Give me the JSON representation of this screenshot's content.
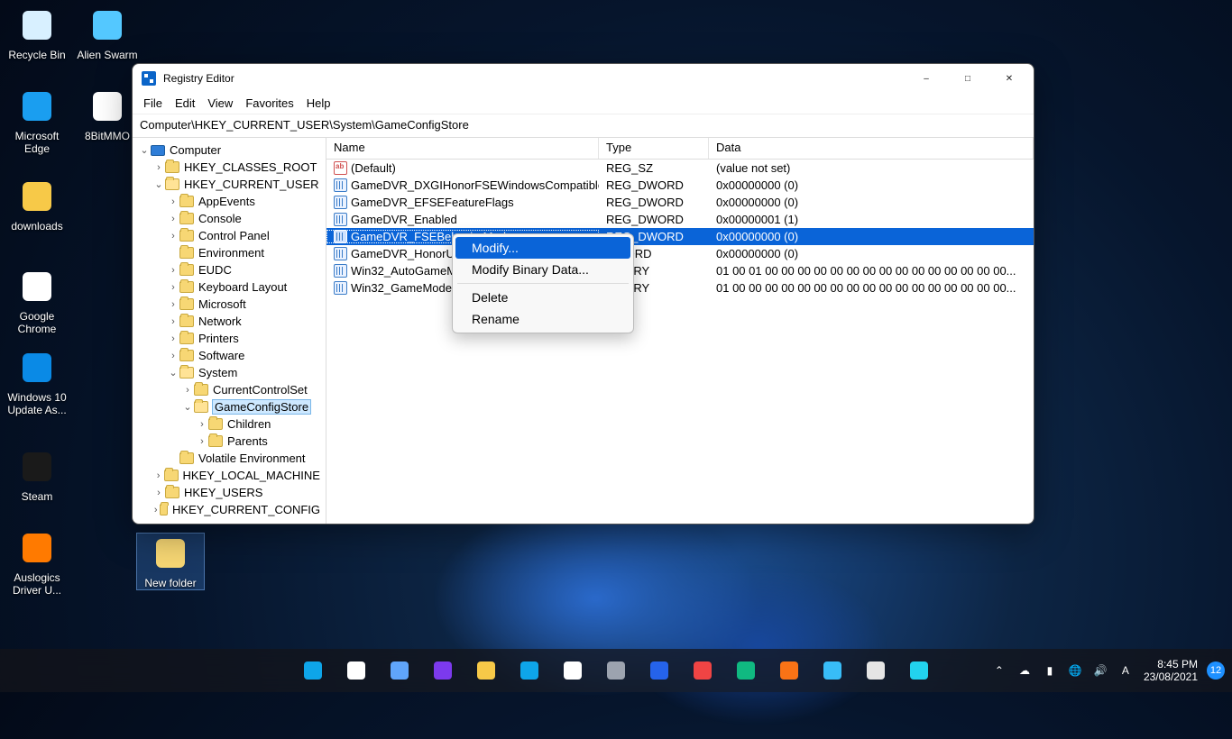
{
  "desktop": [
    {
      "name": "recycle-bin",
      "label": "Recycle Bin",
      "color": "#d8f0ff"
    },
    {
      "name": "alien-swarm",
      "label": "Alien Swarm",
      "color": "#54c8ff"
    },
    {
      "name": "microsoft-edge",
      "label": "Microsoft Edge",
      "color": "#1a9ef0"
    },
    {
      "name": "8bitmmo",
      "label": "8BitMMO",
      "color": "#ffffff"
    },
    {
      "name": "downloads",
      "label": "downloads",
      "color": "#f7c948"
    },
    {
      "name": "google-chrome",
      "label": "Google Chrome",
      "color": "#ffffff"
    },
    {
      "name": "windows10-update-assistant",
      "label": "Windows 10 Update As...",
      "color": "#0a8ae6"
    },
    {
      "name": "steam",
      "label": "Steam",
      "color": "#1a1a1a"
    },
    {
      "name": "auslogics-driver-updater",
      "label": "Auslogics Driver U...",
      "color": "#ff7a00"
    },
    {
      "name": "new-folder",
      "label": "New folder",
      "color": "#f7d774",
      "selected": true
    }
  ],
  "window": {
    "title": "Registry Editor",
    "menus": [
      "File",
      "Edit",
      "View",
      "Favorites",
      "Help"
    ],
    "address": "Computer\\HKEY_CURRENT_USER\\System\\GameConfigStore",
    "tree": [
      {
        "d": 0,
        "tw": "v",
        "ico": "comp",
        "label": "Computer"
      },
      {
        "d": 1,
        "tw": ">",
        "ico": "fld",
        "label": "HKEY_CLASSES_ROOT"
      },
      {
        "d": 1,
        "tw": "v",
        "ico": "fldo",
        "label": "HKEY_CURRENT_USER"
      },
      {
        "d": 2,
        "tw": ">",
        "ico": "fld",
        "label": "AppEvents"
      },
      {
        "d": 2,
        "tw": ">",
        "ico": "fld",
        "label": "Console"
      },
      {
        "d": 2,
        "tw": ">",
        "ico": "fld",
        "label": "Control Panel"
      },
      {
        "d": 2,
        "tw": "",
        "ico": "fld",
        "label": "Environment"
      },
      {
        "d": 2,
        "tw": ">",
        "ico": "fld",
        "label": "EUDC"
      },
      {
        "d": 2,
        "tw": ">",
        "ico": "fld",
        "label": "Keyboard Layout"
      },
      {
        "d": 2,
        "tw": ">",
        "ico": "fld",
        "label": "Microsoft"
      },
      {
        "d": 2,
        "tw": ">",
        "ico": "fld",
        "label": "Network"
      },
      {
        "d": 2,
        "tw": ">",
        "ico": "fld",
        "label": "Printers"
      },
      {
        "d": 2,
        "tw": ">",
        "ico": "fld",
        "label": "Software"
      },
      {
        "d": 2,
        "tw": "v",
        "ico": "fldo",
        "label": "System"
      },
      {
        "d": 3,
        "tw": ">",
        "ico": "fld",
        "label": "CurrentControlSet"
      },
      {
        "d": 3,
        "tw": "v",
        "ico": "fldo",
        "label": "GameConfigStore",
        "sel": true
      },
      {
        "d": 4,
        "tw": ">",
        "ico": "fld",
        "label": "Children"
      },
      {
        "d": 4,
        "tw": ">",
        "ico": "fld",
        "label": "Parents"
      },
      {
        "d": 2,
        "tw": "",
        "ico": "fld",
        "label": "Volatile Environment"
      },
      {
        "d": 1,
        "tw": ">",
        "ico": "fld",
        "label": "HKEY_LOCAL_MACHINE"
      },
      {
        "d": 1,
        "tw": ">",
        "ico": "fld",
        "label": "HKEY_USERS"
      },
      {
        "d": 1,
        "tw": ">",
        "ico": "fld",
        "label": "HKEY_CURRENT_CONFIG"
      }
    ],
    "columns": {
      "name": "Name",
      "type": "Type",
      "data": "Data"
    },
    "values": [
      {
        "ico": "sz",
        "name": "(Default)",
        "type": "REG_SZ",
        "data": "(value not set)"
      },
      {
        "ico": "dw",
        "name": "GameDVR_DXGIHonorFSEWindowsCompatible",
        "type": "REG_DWORD",
        "data": "0x00000000 (0)"
      },
      {
        "ico": "dw",
        "name": "GameDVR_EFSEFeatureFlags",
        "type": "REG_DWORD",
        "data": "0x00000000 (0)"
      },
      {
        "ico": "dw",
        "name": "GameDVR_Enabled",
        "type": "REG_DWORD",
        "data": "0x00000001 (1)"
      },
      {
        "ico": "dw",
        "name": "GameDVR_FSEBehaviorMode",
        "type": "REG_DWORD",
        "data": "0x00000000 (0)",
        "sel": true
      },
      {
        "ico": "dw",
        "name": "GameDVR_HonorUserFSEBehaviorMode",
        "type": "REG_DWORD",
        "data": "0x00000000 (0)",
        "trunc": "GameDVR_HonorUser",
        "ttrunc": "DWORD"
      },
      {
        "ico": "dw",
        "name": "Win32_AutoGameModeDefaultProfile",
        "type": "REG_BINARY",
        "data": "01 00 01 00 00 00 00 00 00 00 00 00 00 00 00 00 00 00...",
        "trunc": "Win32_AutoGameMo",
        "ttrunc": "BINARY"
      },
      {
        "ico": "dw",
        "name": "Win32_GameModeRelatedProcesses",
        "type": "REG_BINARY",
        "data": "01 00 00 00 00 00 00 00 00 00 00 00 00 00 00 00 00 00...",
        "trunc": "Win32_GameModeRe",
        "ttrunc": "BINARY"
      }
    ],
    "context": [
      {
        "label": "Modify...",
        "hl": true
      },
      {
        "label": "Modify Binary Data..."
      },
      {
        "sep": true
      },
      {
        "label": "Delete"
      },
      {
        "label": "Rename"
      }
    ]
  },
  "taskbar": {
    "center_icons": [
      "start",
      "search",
      "task-view",
      "chat",
      "file-explorer",
      "edge",
      "microsoft-store",
      "settings",
      "word",
      "chrome",
      "security",
      "brave",
      "alien-swarm",
      "steam",
      "app"
    ],
    "tray_icons": [
      "chevron-up",
      "onedrive",
      "battery",
      "network",
      "volume",
      "ime"
    ],
    "time": "8:45 PM",
    "date": "23/08/2021",
    "badge": "12"
  }
}
